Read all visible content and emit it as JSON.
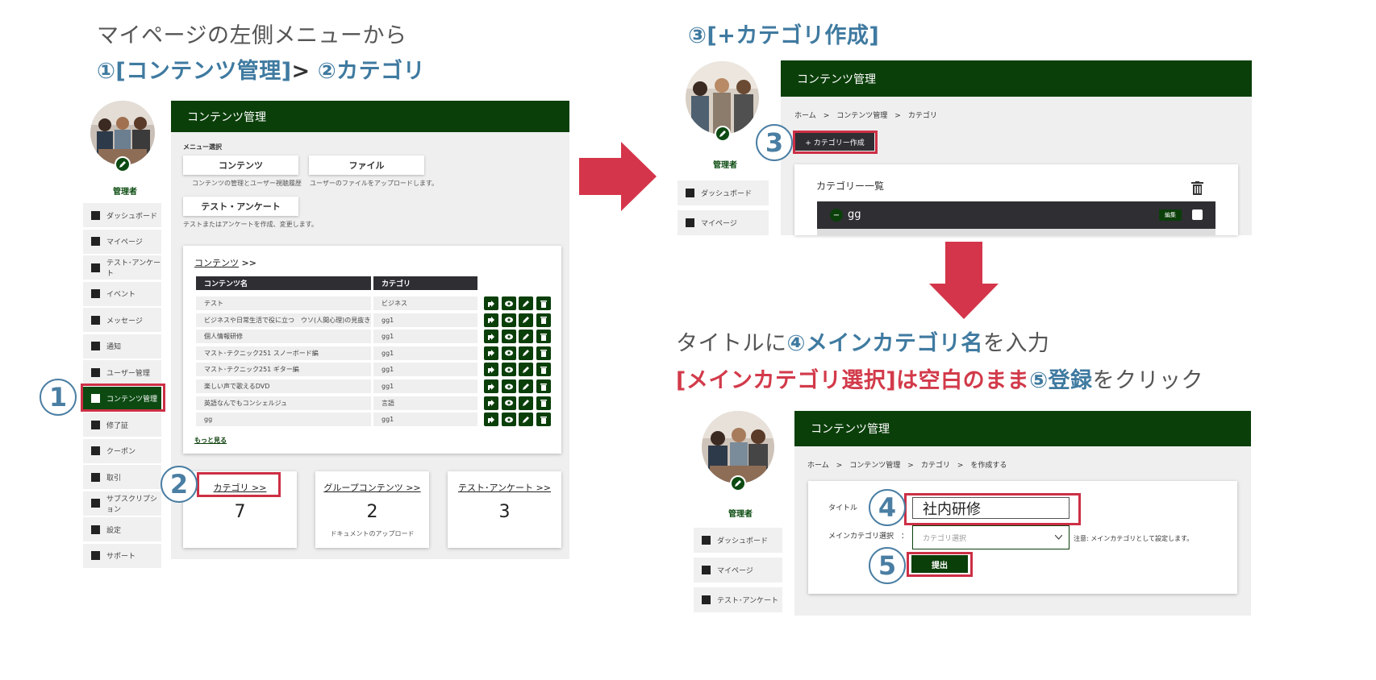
{
  "instructions": {
    "left_line1": "マイページの左側メニューから",
    "left_line2_step1": "①[コンテンツ管理]",
    "left_line2_sep": ">",
    "left_line2_step2": "②カテゴリ",
    "right_step3": "③[+カテゴリ作成]",
    "bottom_line1_a": "タイトルに",
    "bottom_line1_b": "④メインカテゴリ名",
    "bottom_line1_c": "を入力",
    "bottom_line2_a": "[メインカテゴリ選択]は空白のまま",
    "bottom_line2_b": "⑤登録",
    "bottom_line2_c": "をクリック"
  },
  "steps": [
    "1",
    "2",
    "3",
    "4",
    "5"
  ],
  "colors": {
    "brand_green": "#0b3f0a",
    "accent_blue": "#3f7aa0",
    "accent_red": "#d23a4a",
    "arrow_red": "#d4354a"
  },
  "panel1": {
    "role": "管理者",
    "side_menu": [
      {
        "label": "ダッシュボード",
        "icon": "dashboard-icon"
      },
      {
        "label": "マイページ",
        "icon": "book-icon"
      },
      {
        "label": "テスト･アンケート",
        "icon": "test-icon"
      },
      {
        "label": "イベント",
        "icon": "megaphone-icon"
      },
      {
        "label": "メッセージ",
        "icon": "chat-icon"
      },
      {
        "label": "通知",
        "icon": "bell-icon"
      },
      {
        "label": "ユーザー管理",
        "icon": "users-icon"
      },
      {
        "label": "コンテンツ管理",
        "icon": "content-icon"
      },
      {
        "label": "修了証",
        "icon": "medal-icon"
      },
      {
        "label": "クーポン",
        "icon": "coupon-icon"
      },
      {
        "label": "取引",
        "icon": "transaction-icon"
      },
      {
        "label": "サブスクリプション",
        "icon": "subscription-icon"
      },
      {
        "label": "設定",
        "icon": "gear-icon"
      },
      {
        "label": "サポート",
        "icon": "info-icon"
      }
    ],
    "header": "コンテンツ管理",
    "menu_select_label": "メニュー選択",
    "menu_buttons": [
      {
        "label": "コンテンツ",
        "desc": "コンテンツの管理とユーザー視聴履歴"
      },
      {
        "label": "ファイル",
        "desc": "ユーザーのファイルをアップロードします。"
      },
      {
        "label": "テスト・アンケート",
        "desc": "テストまたはアンケートを作成、変更します。"
      }
    ],
    "content_link": "コンテンツ",
    "content_link_suffix": ">>",
    "table_headers": [
      "コンテンツ名",
      "カテゴリ"
    ],
    "rows": [
      {
        "name": "テスト",
        "category": "ビジネス"
      },
      {
        "name": "ビジネスや日常生活で役に立つ　ウソ(人間心理)の見抜き方",
        "category": "gg1"
      },
      {
        "name": "個人情報研修",
        "category": "gg1"
      },
      {
        "name": "マスト･テクニック251 スノーボード編",
        "category": "gg1"
      },
      {
        "name": "マスト･テクニック251 ギター編",
        "category": "gg1"
      },
      {
        "name": "楽しい声で歌えるDVD",
        "category": "gg1"
      },
      {
        "name": "英語なんでもコンシェルジュ",
        "category": "言語"
      },
      {
        "name": "gg",
        "category": "gg1"
      }
    ],
    "more_link": "もっと見る",
    "stats": [
      {
        "title": "カテゴリ >>",
        "value": "7",
        "sub": ""
      },
      {
        "title": "グループコンテンツ >>",
        "value": "2",
        "sub": "ドキュメントのアップロード"
      },
      {
        "title": "テスト･アンケート >>",
        "value": "3",
        "sub": ""
      }
    ]
  },
  "panel2": {
    "role": "管理者",
    "side_menu": [
      {
        "label": "ダッシュボード"
      },
      {
        "label": "マイページ"
      }
    ],
    "header": "コンテンツ管理",
    "breadcrumb": "ホーム　>　コンテンツ管理　>　カテゴリ",
    "create_button": "+ カテゴリー作成",
    "list_title": "カテゴリー一覧",
    "item_name": "gg",
    "item_minus": "−",
    "edit_label": "編集"
  },
  "panel3": {
    "role": "管理者",
    "side_menu": [
      {
        "label": "ダッシュボード"
      },
      {
        "label": "マイページ"
      },
      {
        "label": "テスト･アンケート"
      }
    ],
    "header": "コンテンツ管理",
    "breadcrumb": "ホーム　>　コンテンツ管理　>　カテゴリ　>　を作成する",
    "title_label": "タイトル",
    "title_value": "社内研修",
    "main_cat_label": "メインカテゴリ選択　：",
    "main_cat_placeholder": "カテゴリ選択",
    "note": "注意: メインカテゴリとして設定します。",
    "submit": "提出"
  }
}
